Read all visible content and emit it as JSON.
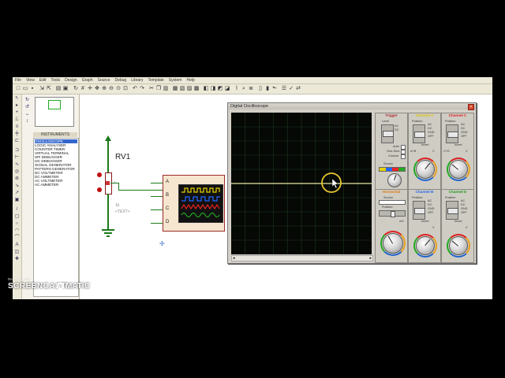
{
  "menu": [
    "File",
    "View",
    "Edit",
    "Tools",
    "Design",
    "Graph",
    "Source",
    "Debug",
    "Library",
    "Template",
    "System",
    "Help"
  ],
  "devices": {
    "header": "INSTRUMENTS",
    "items": [
      "OSCILLOSCOPE",
      "LOGIC ANALYSER",
      "COUNTER TIMER",
      "VIRTUAL TERMINAL",
      "SPI DEBUGGER",
      "I2C DEBUGGER",
      "SIGNAL GENERATOR",
      "PATTERN GENERATOR",
      "DC VOLTMETER",
      "DC AMMETER",
      "AC VOLTMETER",
      "AC AMMETER"
    ],
    "selected_index": 0
  },
  "schematic": {
    "pot_label": "RV1",
    "pot_ref": "1k",
    "text_placeholder": "<TEXT>",
    "pins": [
      "A",
      "B",
      "C",
      "D"
    ]
  },
  "scope": {
    "title": "Digital Oscilloscope",
    "channel_a": "Channel A",
    "channel_b": "Channel B",
    "channel_c": "Channel C",
    "channel_d": "Channel D",
    "trigger": "Trigger",
    "horizontal": "Horizontal",
    "labels": {
      "position": "Position",
      "level": "Level",
      "ac": "AC",
      "dc": "DC",
      "gnd": "GND",
      "off": "OFF",
      "invert": "Invert",
      "auto": "Auto",
      "one_shot": "One-Shot",
      "cursors": "Cursors",
      "source": "Source",
      "a_b": "A+B",
      "c_d": "C+D",
      "ms": "mS",
      "v": "V",
      "mv": "mV"
    }
  },
  "watermark": {
    "line1": "Recorded with",
    "line2": "SCREENCAST",
    "line3": "MATIC"
  },
  "colors": {
    "channel_a": "#e8d200",
    "channel_b": "#2266ff",
    "channel_c": "#ee2222",
    "channel_d": "#22aa22",
    "wire": "#1a7a1a"
  }
}
